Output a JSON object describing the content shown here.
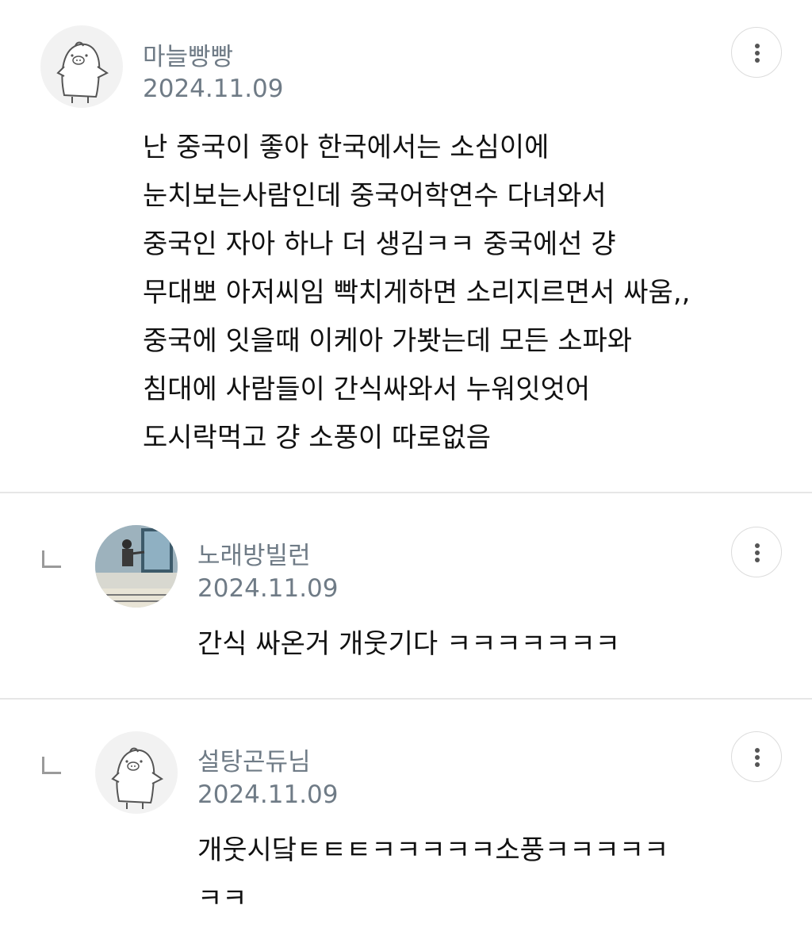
{
  "comments": [
    {
      "author": "마늘빵빵",
      "date": "2024.11.09",
      "lines": [
        "난 중국이 좋아 한국에서는 소심이에",
        "눈치보는사람인데 중국어학연수 다녀와서",
        "중국인 자아 하나 더 생김ㅋㅋ 중국에선 걍",
        "무대뽀 아저씨임 빡치게하면 소리지르면서 싸움,,",
        "중국에 잇을때 이케아 가봣는데 모든 소파와",
        "침대에 사람들이 간식싸와서 누워잇엇어",
        "도시락먹고 걍 소풍이 따로없음"
      ],
      "avatar_icon": "penguin-avatar-icon"
    },
    {
      "author": "노래방빌런",
      "date": "2024.11.09",
      "lines": [
        "간식 싸온거 개웃기다 ㅋㅋㅋㅋㅋㅋㅋ"
      ],
      "avatar_icon": "photo-avatar-icon"
    },
    {
      "author": "설탕곤듀님",
      "date": "2024.11.09",
      "lines": [
        "개웃시닼ㅌㅌㅌㅋㅋㅋㅋㅋ소풍ㅋㅋㅋㅋㅋ",
        "ㅋㅋ"
      ],
      "avatar_icon": "penguin-avatar-icon"
    }
  ],
  "colors": {
    "meta_text": "#6f7b86",
    "body_text": "#111111",
    "divider": "#e6e6e6"
  }
}
